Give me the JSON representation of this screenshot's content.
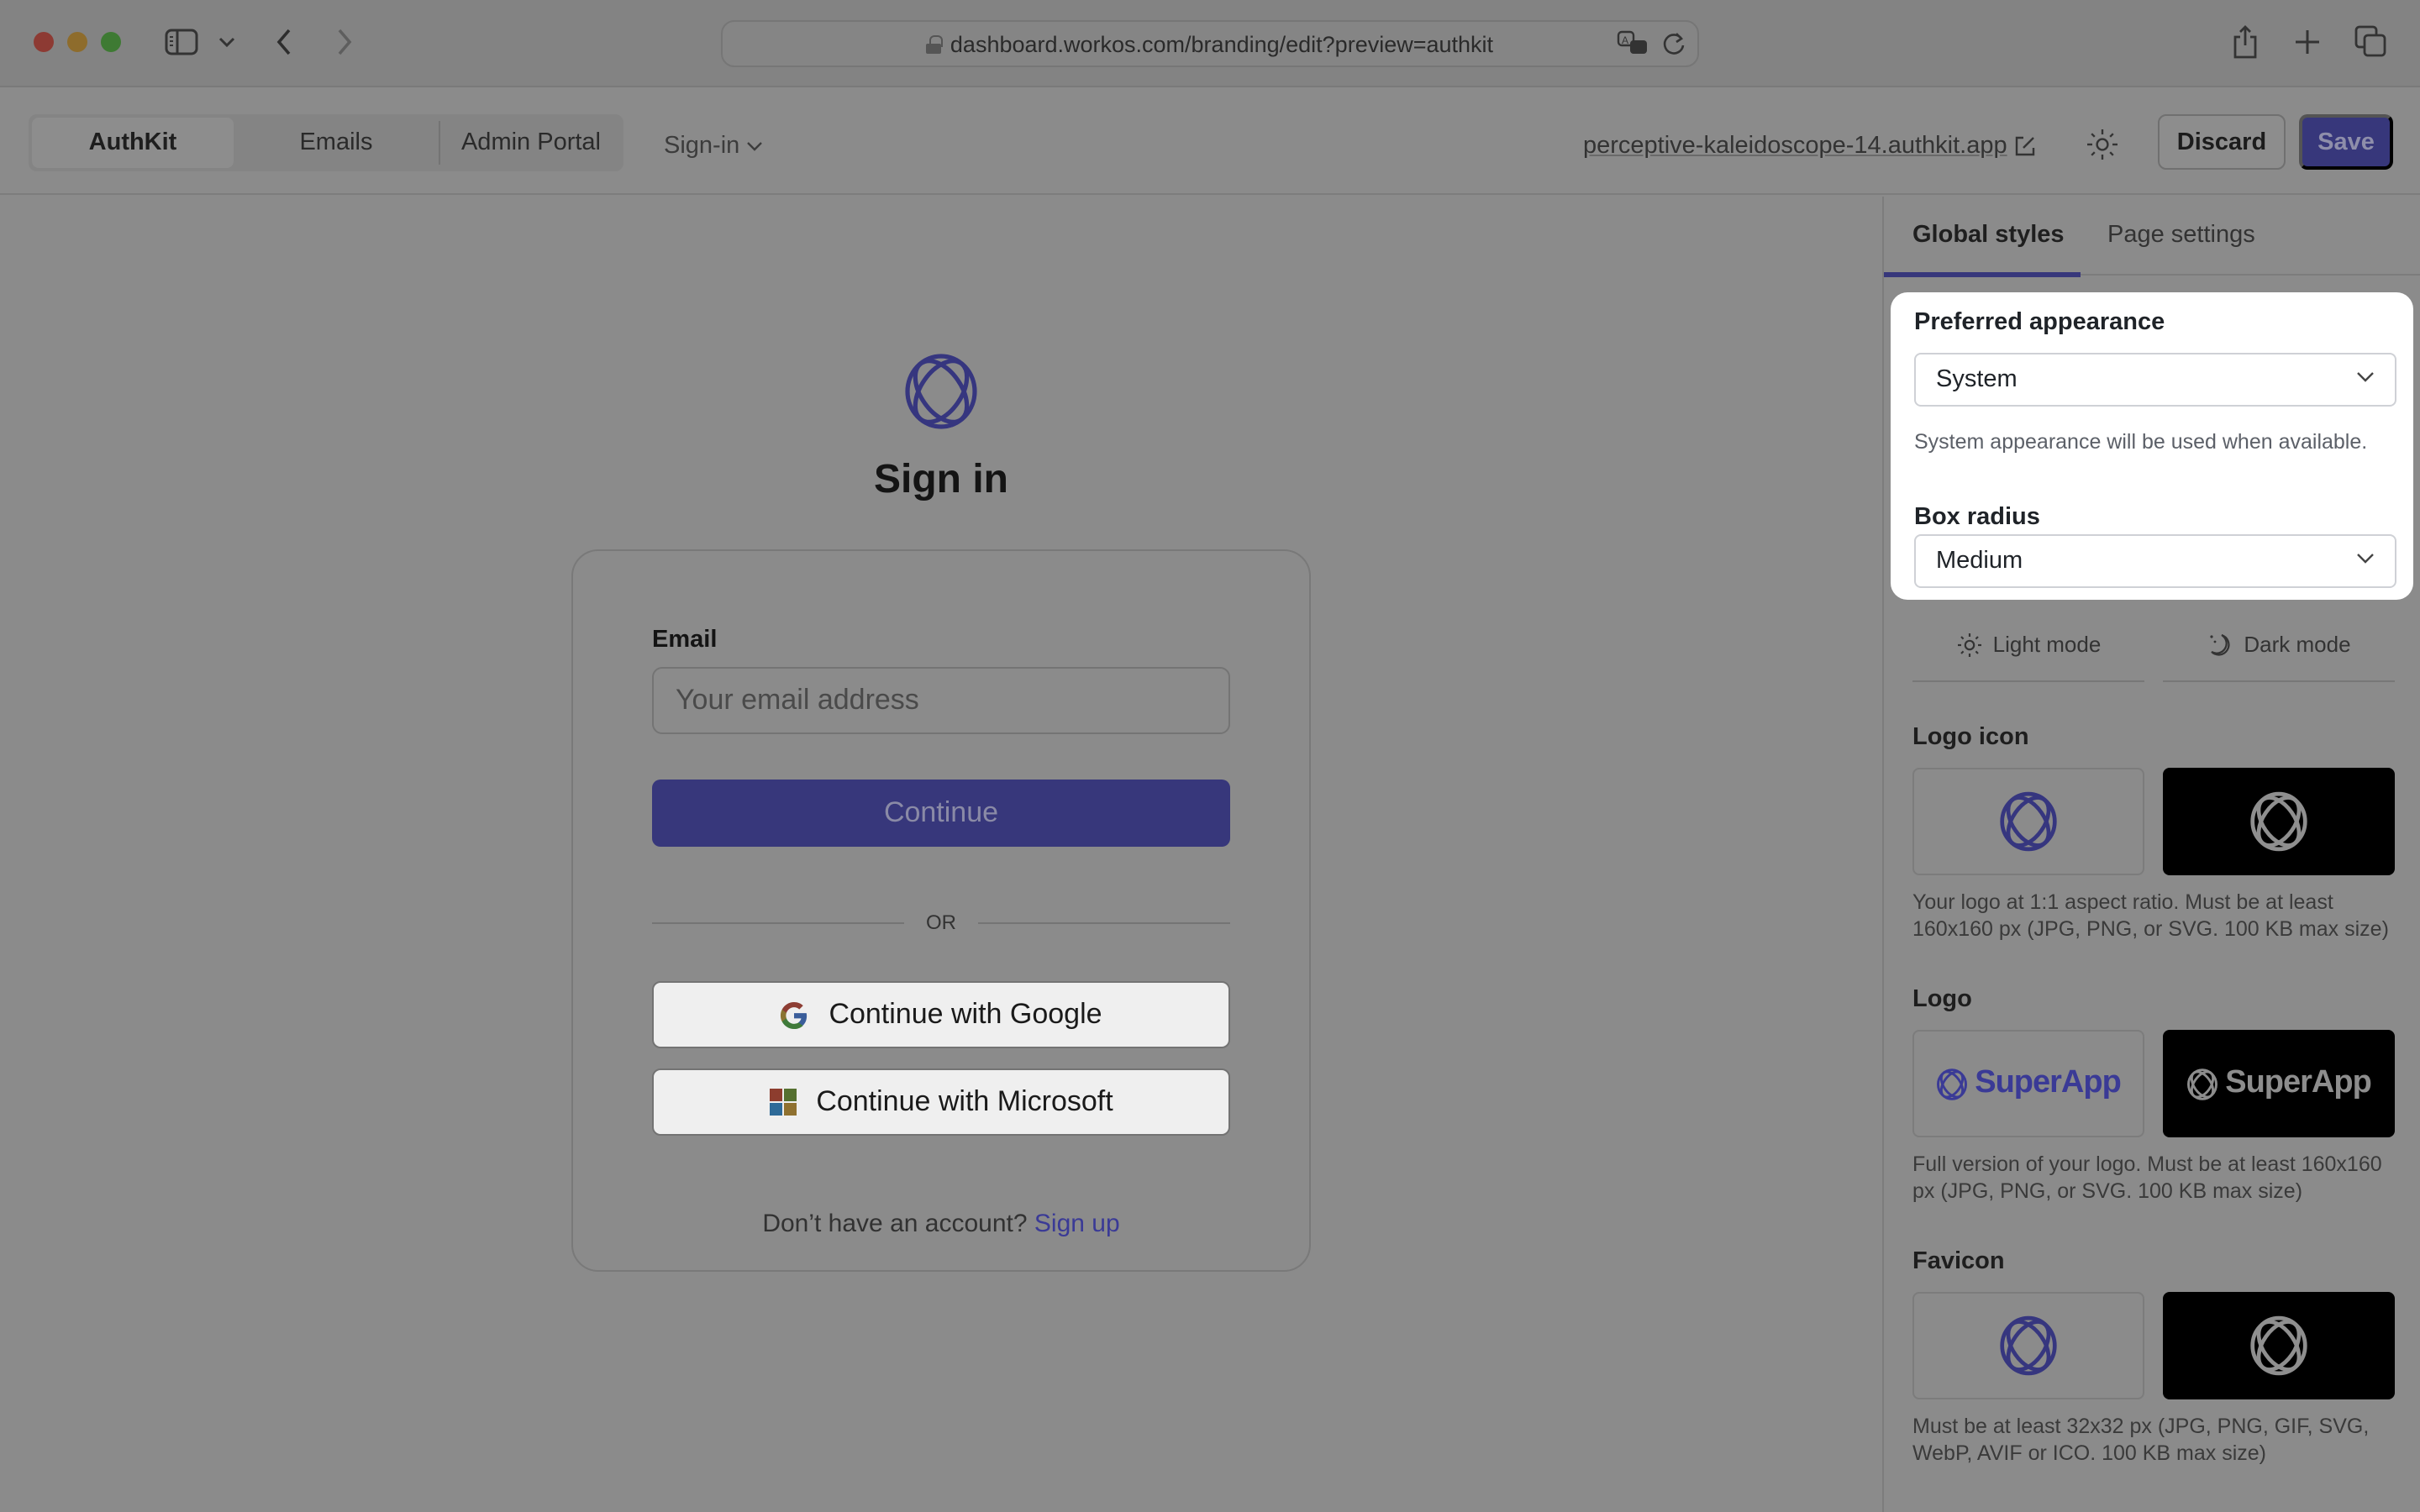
{
  "browser": {
    "url": "dashboard.workos.com/branding/edit?preview=authkit",
    "icons": {
      "sidebar": "sidebar-toggle-icon",
      "back": "chevron-left-icon",
      "forward": "chevron-right-icon",
      "lock": "lock-icon",
      "translate": "translate-icon",
      "reload": "reload-icon",
      "share": "share-icon",
      "new_tab": "plus-icon",
      "tabs": "tab-overview-icon"
    }
  },
  "header": {
    "segments": [
      {
        "label": "AuthKit",
        "active": true
      },
      {
        "label": "Emails",
        "active": false
      },
      {
        "label": "Admin Portal",
        "active": false
      }
    ],
    "page_dropdown": "Sign-in",
    "domain": "perceptive-kaleidoscope-14.authkit.app",
    "discard_label": "Discard",
    "save_label": "Save"
  },
  "preview": {
    "title": "Sign in",
    "email_label": "Email",
    "email_placeholder": "Your email address",
    "continue_label": "Continue",
    "divider_label": "OR",
    "google_label": "Continue with Google",
    "microsoft_label": "Continue with Microsoft",
    "signup_prompt": "Don’t have an account?",
    "signup_link": "Sign up"
  },
  "panel": {
    "tabs": [
      {
        "label": "Global styles",
        "active": true
      },
      {
        "label": "Page settings",
        "active": false
      }
    ],
    "appearance": {
      "label": "Preferred appearance",
      "value": "System",
      "help": "System appearance will be used when available."
    },
    "radius": {
      "label": "Box radius",
      "value": "Medium"
    },
    "mode_tabs": {
      "light": "Light mode",
      "dark": "Dark mode"
    },
    "logo_icon": {
      "title": "Logo icon",
      "desc": "Your logo at 1:1 aspect ratio. Must be at least 160x160 px (JPG, PNG, or SVG. 100 KB max size)"
    },
    "logo": {
      "title": "Logo",
      "wordmark": "SuperApp",
      "desc": "Full version of your logo. Must be at least 160x160 px (JPG, PNG, or SVG. 100 KB max size)"
    },
    "favicon": {
      "title": "Favicon",
      "desc": "Must be at least 32x32 px (JPG, PNG, GIF, SVG, WebP, AVIF or ICO. 100 KB max size)"
    }
  },
  "colors": {
    "brand": "#4040c0",
    "overlay_tint": "#8b8b8b",
    "highlight_card": "#ffffff"
  }
}
